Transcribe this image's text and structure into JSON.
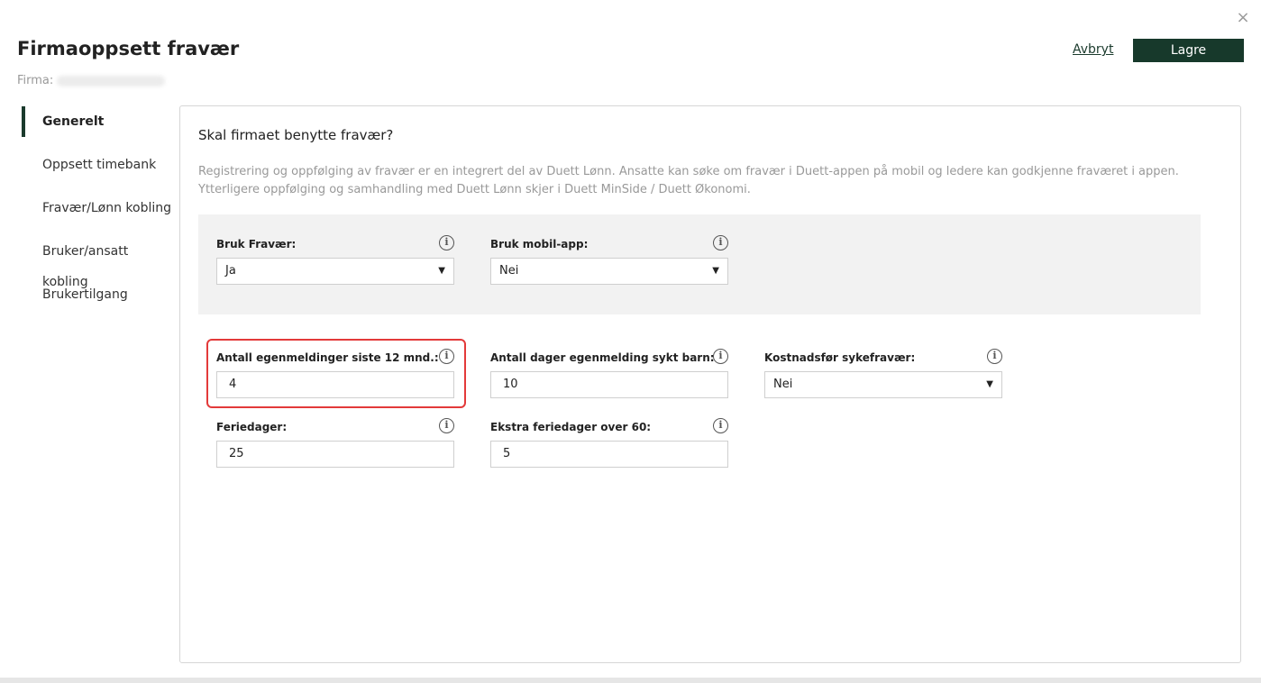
{
  "header": {
    "title": "Firmaoppsett fravær",
    "firma_label": "Firma:",
    "cancel_label": "Avbryt",
    "save_label": "Lagre",
    "close_symbol": "×"
  },
  "sidebar": {
    "items": [
      {
        "label": "Generelt"
      },
      {
        "label": "Oppsett timebank"
      },
      {
        "label": "Fravær/Lønn kobling"
      },
      {
        "label": "Bruker/ansatt kobling"
      },
      {
        "label": "Brukertilgang"
      }
    ]
  },
  "main": {
    "heading": "Skal firmaet benytte fravær?",
    "description": "Registrering og oppfølging av fravær er en integrert del av Duett Lønn. Ansatte kan søke om fravær i Duett-appen på mobil og ledere kan godkjenne fraværet i appen. Ytterligere oppfølging og samhandling med Duett Lønn skjer i Duett MinSide / Duett Økonomi.",
    "fields": {
      "bruk_fravaer": {
        "label": "Bruk Fravær:",
        "value": "Ja"
      },
      "bruk_mobilapp": {
        "label": "Bruk mobil-app:",
        "value": "Nei"
      },
      "egenmeldinger": {
        "label": "Antall egenmeldinger siste 12 mnd.:",
        "value": "4"
      },
      "sykt_barn": {
        "label": "Antall dager egenmelding sykt barn:",
        "value": "10"
      },
      "kostnadsfor": {
        "label": "Kostnadsfør sykefravær:",
        "value": "Nei"
      },
      "feriedager": {
        "label": "Feriedager:",
        "value": "25"
      },
      "ekstra_feriedager": {
        "label": "Ekstra feriedager over 60:",
        "value": "5"
      }
    },
    "info_symbol": "i",
    "dropdown_caret": "▼"
  },
  "colors": {
    "accent": "#17392b",
    "highlight": "#e33a3a",
    "muted_text": "#999999"
  }
}
